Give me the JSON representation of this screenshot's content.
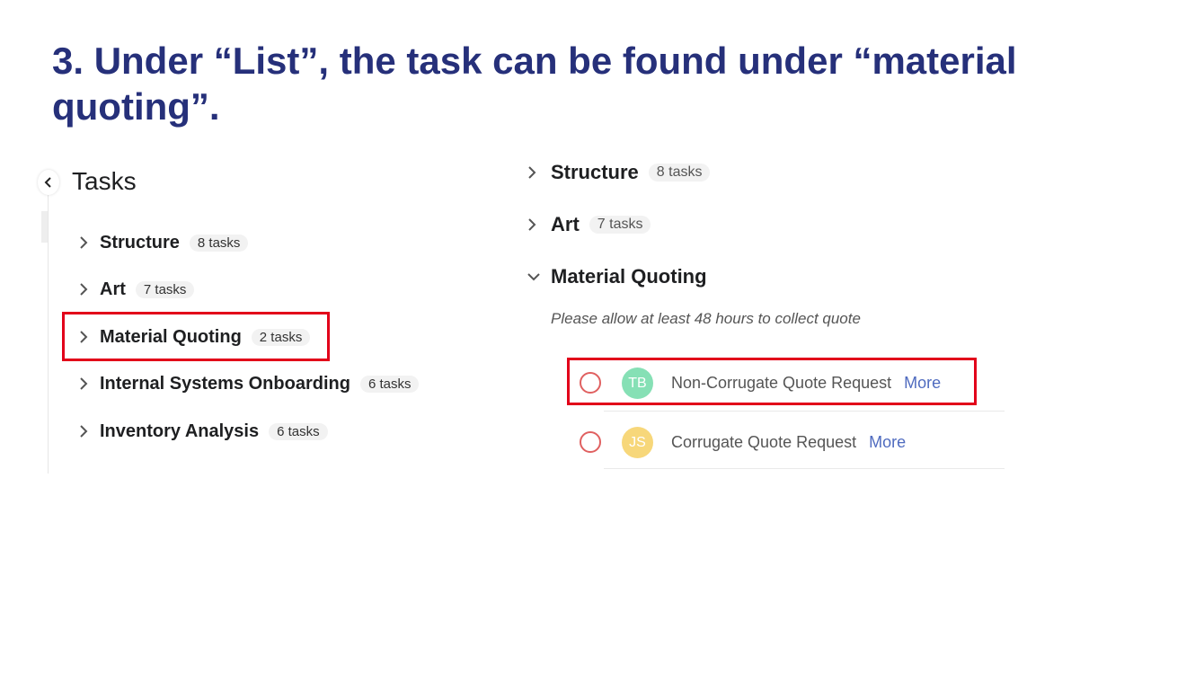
{
  "slide": {
    "title": "3. Under “List”, the task can be found under “material quoting”."
  },
  "left": {
    "heading": "Tasks",
    "sections": [
      {
        "name": "Structure",
        "count": "8 tasks"
      },
      {
        "name": "Art",
        "count": "7 tasks"
      },
      {
        "name": "Material Quoting",
        "count": "2 tasks"
      },
      {
        "name": "Internal Systems Onboarding",
        "count": "6 tasks"
      },
      {
        "name": "Inventory Analysis",
        "count": "6 tasks"
      }
    ]
  },
  "right": {
    "sections": [
      {
        "name": "Structure",
        "count": "8 tasks"
      },
      {
        "name": "Art",
        "count": "7 tasks"
      },
      {
        "name": "Material Quoting"
      }
    ],
    "description": "Please allow at least 48 hours to collect quote",
    "tasks": [
      {
        "name": "Non-Corrugate Quote Request",
        "more": "More",
        "avatar": "TB",
        "avatar_color": "#86e0b5"
      },
      {
        "name": "Corrugate Quote Request",
        "more": "More",
        "avatar": "JS",
        "avatar_color": "#f7d77a"
      }
    ]
  },
  "colors": {
    "title": "#26307a",
    "highlight": "#e2001a",
    "link": "#4f6bbf"
  }
}
